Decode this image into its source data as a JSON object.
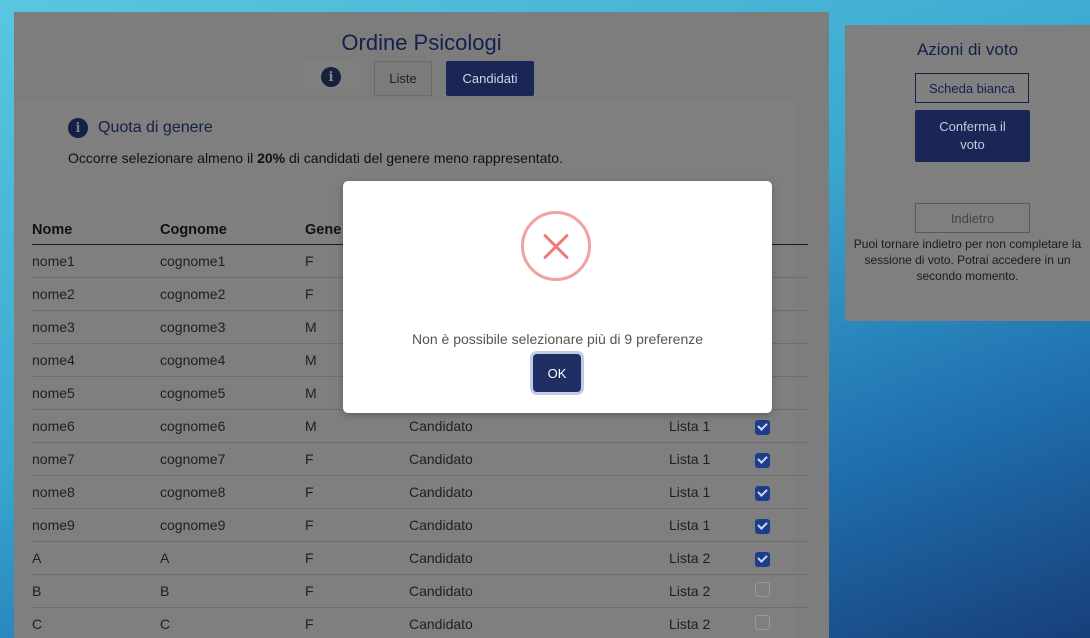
{
  "header": {
    "title": "Ordine Psicologi"
  },
  "tabs": {
    "liste": "Liste",
    "candidati": "Candidati"
  },
  "quota": {
    "title": "Quota di genere",
    "text_before": "Occorre selezionare almeno il ",
    "text_bold": "20%",
    "text_after": " di candidati del genere meno rappresentato."
  },
  "table": {
    "headers": [
      "Nome",
      "Cognome",
      "Gene"
    ],
    "rows": [
      {
        "nome": "nome1",
        "cognome": "cognome1",
        "genere": "F",
        "ruolo": "",
        "lista": "",
        "checked": true
      },
      {
        "nome": "nome2",
        "cognome": "cognome2",
        "genere": "F",
        "ruolo": "",
        "lista": "",
        "checked": true
      },
      {
        "nome": "nome3",
        "cognome": "cognome3",
        "genere": "M",
        "ruolo": "",
        "lista": "",
        "checked": true
      },
      {
        "nome": "nome4",
        "cognome": "cognome4",
        "genere": "M",
        "ruolo": "",
        "lista": "",
        "checked": true
      },
      {
        "nome": "nome5",
        "cognome": "cognome5",
        "genere": "M",
        "ruolo": "",
        "lista": "",
        "checked": true
      },
      {
        "nome": "nome6",
        "cognome": "cognome6",
        "genere": "M",
        "ruolo": "Candidato",
        "lista": "Lista 1",
        "checked": true
      },
      {
        "nome": "nome7",
        "cognome": "cognome7",
        "genere": "F",
        "ruolo": "Candidato",
        "lista": "Lista 1",
        "checked": true
      },
      {
        "nome": "nome8",
        "cognome": "cognome8",
        "genere": "F",
        "ruolo": "Candidato",
        "lista": "Lista 1",
        "checked": true
      },
      {
        "nome": "nome9",
        "cognome": "cognome9",
        "genere": "F",
        "ruolo": "Candidato",
        "lista": "Lista 1",
        "checked": true
      },
      {
        "nome": "A",
        "cognome": "A",
        "genere": "F",
        "ruolo": "Candidato",
        "lista": "Lista 2",
        "checked": true
      },
      {
        "nome": "B",
        "cognome": "B",
        "genere": "F",
        "ruolo": "Candidato",
        "lista": "Lista 2",
        "checked": false
      },
      {
        "nome": "C",
        "cognome": "C",
        "genere": "F",
        "ruolo": "Candidato",
        "lista": "Lista 2",
        "checked": false
      }
    ]
  },
  "sidebar": {
    "title": "Azioni di voto",
    "scheda_bianca": "Scheda bianca",
    "conferma_line1": "Conferma il",
    "conferma_line2": "voto",
    "indietro": "Indietro",
    "note": "Puoi tornare indietro per non completare la sessione di voto. Potrai accedere in un secondo momento."
  },
  "modal": {
    "message": "Non è possibile selezionare più di 9 preferenze",
    "ok_label": "OK"
  },
  "colors": {
    "accent": "#1a2656",
    "error": "#f07a7a",
    "overlay_panel": "#7f7f7f"
  },
  "icons": {
    "info": "info-icon",
    "error": "error-x-icon",
    "check": "checkbox"
  }
}
